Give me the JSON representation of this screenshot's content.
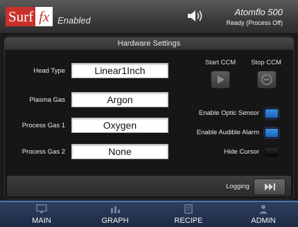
{
  "header": {
    "logo_left": "Surf",
    "logo_right": "fx",
    "status": "Enabled",
    "device_name": "Atomflo 500",
    "device_state": "Ready (Process Off)"
  },
  "panel": {
    "title": "Hardware Settings",
    "fields": [
      {
        "label": "Head Type",
        "value": "Linear1Inch"
      },
      {
        "label": "Plasma Gas",
        "value": "Argon"
      },
      {
        "label": "Process Gas 1",
        "value": "Oxygen"
      },
      {
        "label": "Process Gas 2",
        "value": "None"
      }
    ],
    "ccm": {
      "start_label": "Start CCM",
      "stop_label": "Stop CCM"
    },
    "options": [
      {
        "label": "Enable Optic Sensor",
        "state": "on"
      },
      {
        "label": "Enable Audible Alarm",
        "state": "on"
      },
      {
        "label": "Hide Cursor",
        "state": "off"
      }
    ],
    "logging_label": "Logging"
  },
  "nav": [
    {
      "label": "MAIN",
      "icon": "monitor-icon"
    },
    {
      "label": "GRAPH",
      "icon": "bar-chart-icon"
    },
    {
      "label": "RECIPE",
      "icon": "document-icon"
    },
    {
      "label": "ADMIN",
      "icon": "user-icon"
    }
  ],
  "colors": {
    "logo_red": "#c8312a",
    "toggle_on": "#2a78d2",
    "nav_bg": "#1d2a44",
    "nav_accent": "#4a78b8"
  }
}
